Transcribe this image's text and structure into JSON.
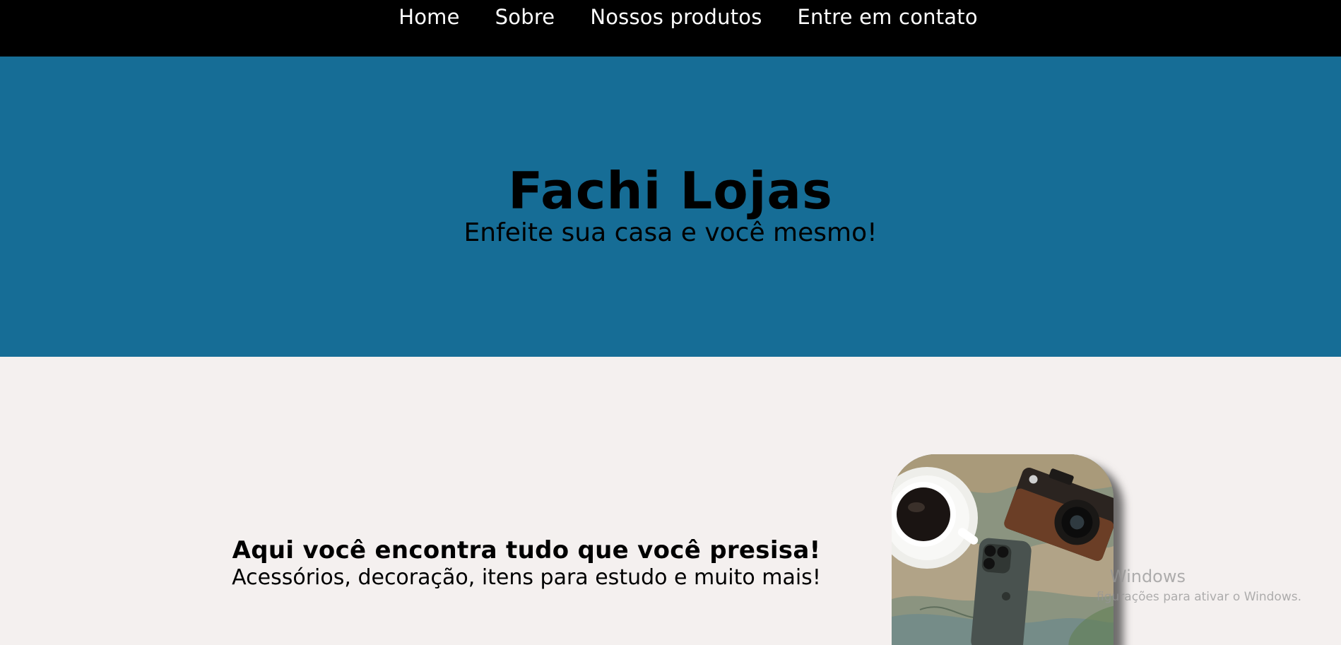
{
  "nav": {
    "items": [
      {
        "label": "Home"
      },
      {
        "label": "Sobre"
      },
      {
        "label": "Nossos produtos"
      },
      {
        "label": "Entre em contato"
      }
    ]
  },
  "hero": {
    "title": "Fachi Lojas",
    "subtitle": "Enfeite sua casa e você mesmo!"
  },
  "feature": {
    "heading": "Aqui você encontra tudo que você presisa!",
    "text": "Acessórios, decoração, itens para estudo e muito mais!"
  },
  "watermark": {
    "title": "Windows",
    "subtitle": "figurações para ativar o Windows."
  },
  "colors": {
    "nav_background": "#000000",
    "hero_background": "#166d96",
    "page_background": "#f4f0ef"
  }
}
